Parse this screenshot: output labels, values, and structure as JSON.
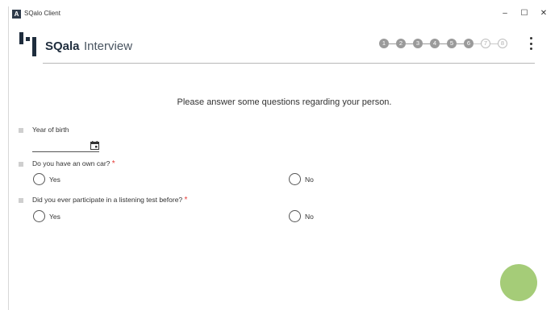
{
  "window": {
    "app_icon_glyph": "A",
    "title": "SQalo Client",
    "minimize": "–",
    "maximize": "☐",
    "close": "✕"
  },
  "header": {
    "brand": "SQala",
    "page_title": "Interview",
    "steps": [
      {
        "label": "1",
        "state": "done"
      },
      {
        "label": "2",
        "state": "done"
      },
      {
        "label": "3",
        "state": "done"
      },
      {
        "label": "4",
        "state": "done"
      },
      {
        "label": "5",
        "state": "done"
      },
      {
        "label": "6",
        "state": "done"
      },
      {
        "label": "7",
        "state": "todo"
      },
      {
        "label": "8",
        "state": "todo"
      }
    ],
    "menu_icon": "more-vertical-icon"
  },
  "form": {
    "intro": "Please answer some questions regarding your person.",
    "questions": [
      {
        "label": "Year of birth",
        "required": false,
        "value": ""
      },
      {
        "label": "Do you have an own car?",
        "required": true,
        "options": [
          "Yes",
          "No"
        ]
      },
      {
        "label": "Did you ever participate in a listening test before?",
        "required": true,
        "options": [
          "Yes",
          "No"
        ]
      }
    ],
    "required_marker": "*"
  },
  "colors": {
    "accent": "#a5cc78",
    "required": "#e53935",
    "step_done": "#9a9a9a"
  }
}
